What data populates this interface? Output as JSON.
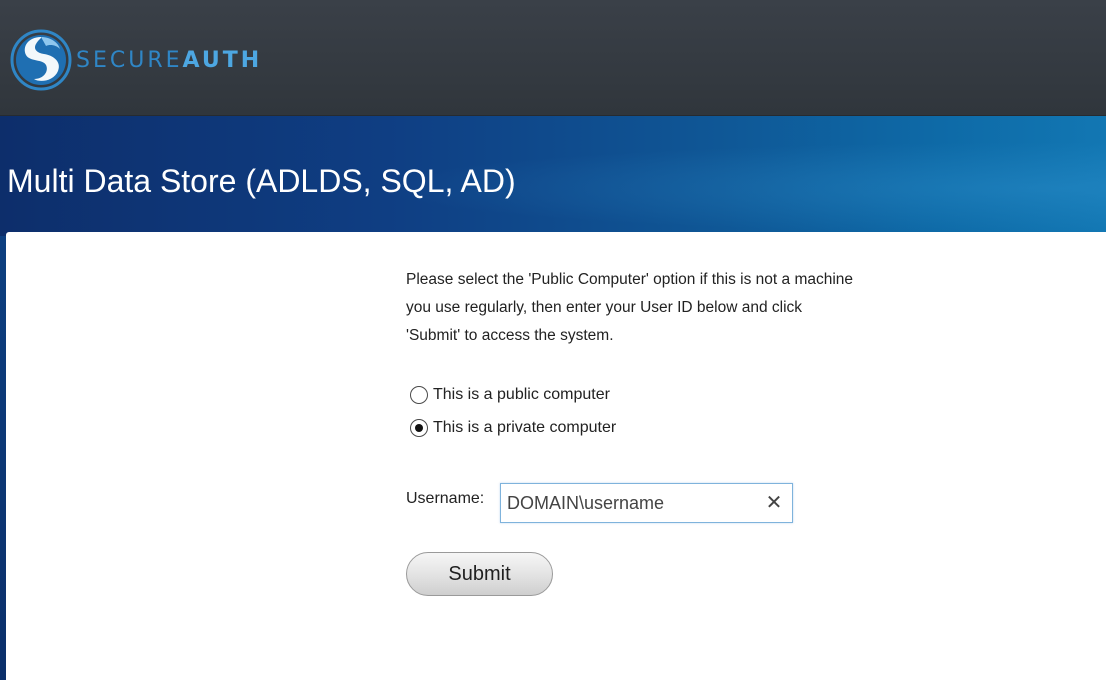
{
  "header": {
    "logo_icon": "secureauth-logo-icon",
    "brand_part1": "SECURE",
    "brand_part2": "AUTH",
    "brand_color": "#2f86c6"
  },
  "page": {
    "title": "Multi Data Store (ADLDS, SQL, AD)"
  },
  "instructions": {
    "line1": "Please select the 'Public Computer' option if this is not a machine",
    "line2": "you use regularly, then enter your User ID below and click",
    "line3": "'Submit' to access the system."
  },
  "computer_type": {
    "options": [
      {
        "label": "This is a public computer",
        "selected": false
      },
      {
        "label": "This is a private computer",
        "selected": true
      }
    ]
  },
  "username": {
    "label": "Username:",
    "value": "DOMAIN\\username",
    "clear_icon": "close-icon"
  },
  "actions": {
    "submit_label": "Submit"
  },
  "colors": {
    "header_bg": "#343a41",
    "band_start": "#0d2e6b",
    "band_end": "#1277b3",
    "input_border": "#7fb3dc"
  }
}
